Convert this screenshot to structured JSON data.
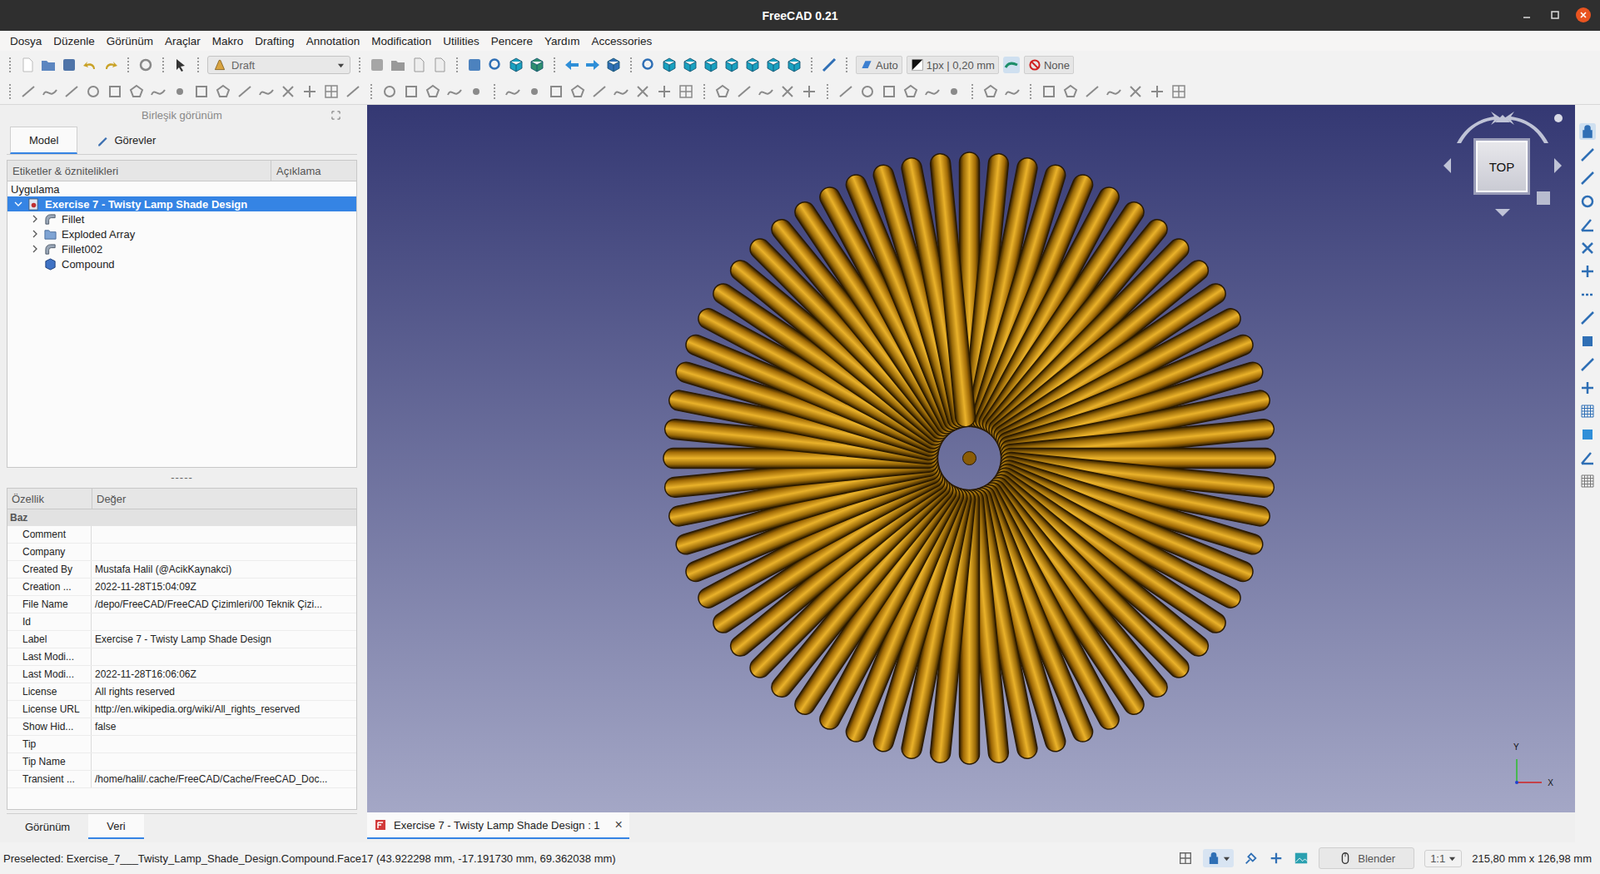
{
  "window": {
    "title": "FreeCAD 0.21"
  },
  "menu": [
    "Dosya",
    "Düzenle",
    "Görünüm",
    "Araçlar",
    "Makro",
    "Drafting",
    "Annotation",
    "Modification",
    "Utilities",
    "Pencere",
    "Yardım",
    "Accessories"
  ],
  "toolbar": {
    "workbench": "Draft",
    "snap": "Auto",
    "line_style": "1px | 0,20 mm",
    "annotation_style": "None"
  },
  "combo_view": {
    "title": "Birleşik görünüm",
    "tabs": [
      {
        "label": "Model",
        "selected": true
      },
      {
        "label": "Görevler",
        "selected": false
      }
    ]
  },
  "tree": {
    "columns": [
      "Etiketler & öznitelikleri",
      "Açıklama"
    ],
    "group": "Uygulama",
    "root": {
      "label": "Exercise 7 - Twisty Lamp Shade Design",
      "expanded": true,
      "selected": true
    },
    "items": [
      {
        "label": "Fillet",
        "kind": "fillet",
        "expandable": true,
        "expanded": false,
        "selected": false
      },
      {
        "label": "Exploded Array",
        "kind": "folder",
        "expandable": true,
        "expanded": false,
        "selected": false
      },
      {
        "label": "Fillet002",
        "kind": "fillet",
        "expandable": true,
        "expanded": false,
        "selected": false
      },
      {
        "label": "Compound",
        "kind": "compound",
        "expandable": false,
        "expanded": false,
        "selected": false
      }
    ]
  },
  "splitter": "-----",
  "properties": {
    "columns": [
      "Özellik",
      "Değer"
    ],
    "group": "Baz",
    "rows": [
      {
        "name": "Comment",
        "value": ""
      },
      {
        "name": "Company",
        "value": ""
      },
      {
        "name": "Created By",
        "value": "Mustafa Halil (@AcikKaynakci)"
      },
      {
        "name": "Creation ...",
        "value": "2022-11-28T15:04:09Z"
      },
      {
        "name": "File Name",
        "value": "/depo/FreeCAD/FreeCAD Çizimleri/00 Teknik Çizi..."
      },
      {
        "name": "Id",
        "value": ""
      },
      {
        "name": "Label",
        "value": "Exercise 7 - Twisty Lamp Shade Design"
      },
      {
        "name": "Last Modi...",
        "value": ""
      },
      {
        "name": "Last Modi...",
        "value": "2022-11-28T16:06:06Z"
      },
      {
        "name": "License",
        "value": "All rights reserved"
      },
      {
        "name": "License URL",
        "value": "http://en.wikipedia.org/wiki/All_rights_reserved"
      },
      {
        "name": "Show Hid...",
        "value": "false"
      },
      {
        "name": "Tip",
        "value": ""
      },
      {
        "name": "Tip Name",
        "value": ""
      },
      {
        "name": "Transient ...",
        "value": "/home/halil/.cache/FreeCAD/Cache/FreeCAD_Doc..."
      }
    ]
  },
  "bottom_tabs": [
    {
      "label": "Görünüm",
      "selected": false
    },
    {
      "label": "Veri",
      "selected": true
    }
  ],
  "viewport": {
    "nav_cube": "TOP",
    "axes": [
      "Y",
      "X"
    ]
  },
  "document_tab": {
    "label": "Exercise 7 - Twisty Lamp Shade Design : 1",
    "close": "×",
    "selected": true
  },
  "status_bar": {
    "text": "Preselected: Exercise_7___Twisty_Lamp_Shade_Design.Compound.Face17 (43.922298 mm, -17.191730 mm, 69.362038 mm)",
    "navigation": "Blender",
    "zoom": "1:1",
    "dimensions": "215,80 mm x 126,98 mm"
  }
}
